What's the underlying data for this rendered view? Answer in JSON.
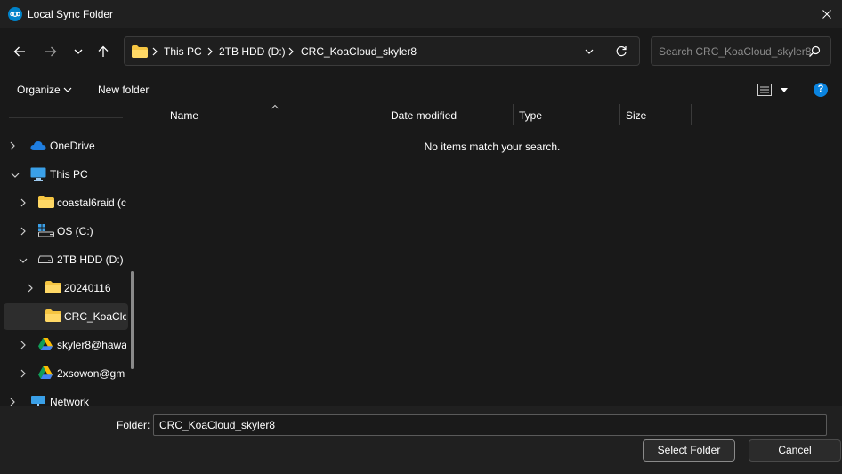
{
  "window": {
    "title": "Local Sync Folder",
    "app_icon": "nextcloud-icon",
    "accent": "#0082c9"
  },
  "address": {
    "crumbs": [
      "This PC",
      "2TB HDD (D:)",
      "CRC_KoaCloud_skyler8"
    ]
  },
  "search": {
    "placeholder": "Search CRC_KoaCloud_skyler8"
  },
  "toolbar": {
    "organize_label": "Organize",
    "new_folder_label": "New folder",
    "help_label": "?"
  },
  "nav": {
    "items": [
      {
        "label": "OneDrive",
        "icon": "cloud-icon"
      },
      {
        "label": "This PC",
        "icon": "monitor-icon"
      },
      {
        "label": "coastal6raid (c",
        "icon": "folder-icon"
      },
      {
        "label": "OS (C:)",
        "icon": "windows-drive-icon"
      },
      {
        "label": "2TB HDD (D:)",
        "icon": "drive-icon"
      },
      {
        "label": "20240116",
        "icon": "folder-icon"
      },
      {
        "label": "CRC_KoaClou",
        "icon": "folder-icon"
      },
      {
        "label": "skyler8@hawa",
        "icon": "google-drive-icon"
      },
      {
        "label": "2xsowon@gm",
        "icon": "google-drive-icon"
      },
      {
        "label": "Network",
        "icon": "network-icon"
      }
    ]
  },
  "columns": {
    "name": "Name",
    "date": "Date modified",
    "type": "Type",
    "size": "Size"
  },
  "content": {
    "empty_message": "No items match your search."
  },
  "footer": {
    "folder_label": "Folder:",
    "folder_value": "CRC_KoaCloud_skyler8",
    "select_label": "Select Folder",
    "cancel_label": "Cancel"
  }
}
